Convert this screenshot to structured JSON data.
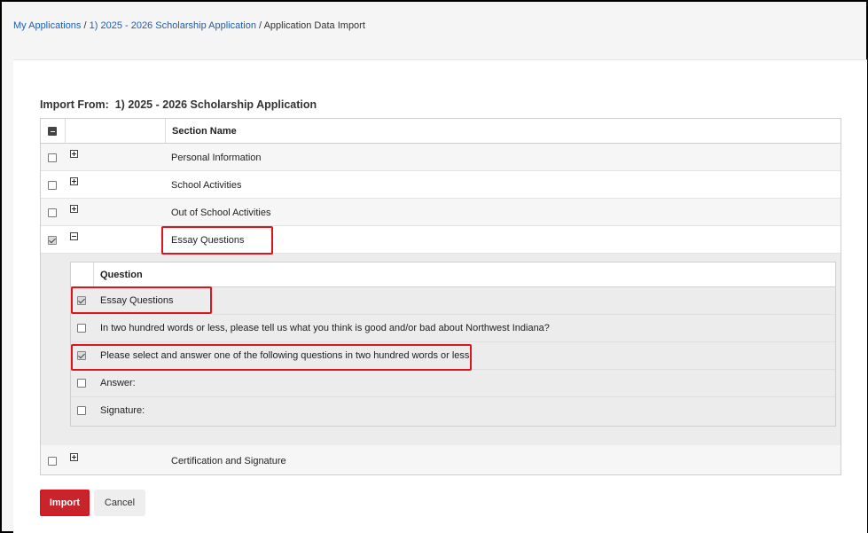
{
  "breadcrumb": {
    "items": [
      "My Applications",
      "1) 2025 - 2026 Scholarship Application"
    ],
    "separator": "/",
    "current": "Application Data Import"
  },
  "import_from": {
    "label": "Import From:",
    "value": "1) 2025 - 2026 Scholarship Application"
  },
  "sections_table": {
    "header": "Section Name",
    "rows": [
      {
        "label": "Personal Information",
        "checked": false,
        "expanded": false
      },
      {
        "label": "School Activities",
        "checked": false,
        "expanded": false
      },
      {
        "label": "Out of School Activities",
        "checked": false,
        "expanded": false
      },
      {
        "label": "Essay Questions",
        "checked": true,
        "expanded": true
      },
      {
        "label": "Certification and Signature",
        "checked": false,
        "expanded": false
      }
    ]
  },
  "questions_table": {
    "header": "Question",
    "rows": [
      {
        "label": "Essay Questions",
        "checked": true
      },
      {
        "label": "In two hundred words or less, please tell us what you think is good and/or bad about Northwest Indiana?",
        "checked": false
      },
      {
        "label": "Please select and answer one of the following questions in two hundred words or less.",
        "checked": true
      },
      {
        "label": "Answer:",
        "checked": false
      },
      {
        "label": "Signature:",
        "checked": false
      }
    ]
  },
  "buttons": {
    "import": "Import",
    "cancel": "Cancel"
  },
  "colors": {
    "link": "#1a5fb4",
    "import_button": "#c8242c",
    "highlight": "#e0141e"
  }
}
